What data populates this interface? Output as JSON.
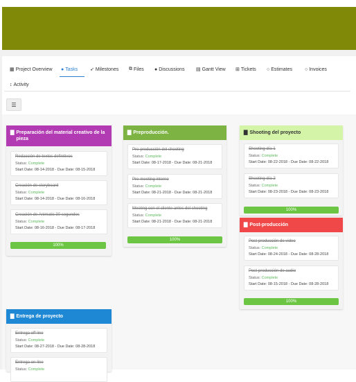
{
  "nav": {
    "tabs": [
      {
        "label": "Project Overview",
        "icon": "grid-icon"
      },
      {
        "label": "Tasks",
        "icon": "check-circle-icon",
        "active": true
      },
      {
        "label": "Milestones",
        "icon": "rocket-icon"
      },
      {
        "label": "Files",
        "icon": "files-icon"
      },
      {
        "label": "Discussions",
        "icon": "comments-icon"
      },
      {
        "label": "Gantt View",
        "icon": "bar-chart-icon"
      },
      {
        "label": "Tickets",
        "icon": "ticket-icon"
      },
      {
        "label": "Estimates",
        "icon": "estimate-icon"
      },
      {
        "label": "Invoices",
        "icon": "invoice-icon"
      },
      {
        "label": "Activity",
        "icon": "activity-icon"
      }
    ]
  },
  "colors": {
    "banner": "#808a08",
    "accent": "#2a7fd4",
    "status": "#5cb85c",
    "progress": "#6cc644"
  },
  "columns": [
    {
      "title": "Preparación del material creativo de la pieza",
      "color": "#b23ab2",
      "tasks": [
        {
          "name": "Redacción de textos definitivos",
          "status_label": "Status:",
          "status": "Complete",
          "dates": "Start Date: 08-14-2018 - Due Date: 08-15-2018"
        },
        {
          "name": "Creación de storyboard",
          "status_label": "Status:",
          "status": "Complete",
          "dates": "Start Date: 08-14-2018 - Due Date: 08-16-2018"
        },
        {
          "name": "Creación de Animatic 30 segundos",
          "status_label": "Status:",
          "status": "Complete",
          "dates": "Start Date: 08-16-2018 - Due Date: 08-17-2018"
        }
      ],
      "progress": "100%",
      "progress_value": 100
    },
    {
      "title": "Preproducción.",
      "color": "#7cb342",
      "tasks": [
        {
          "name": "Pre-producción del shooting",
          "status_label": "Status:",
          "status": "Complete",
          "dates": "Start Date: 08-17-2018 - Due Date: 08-21-2018"
        },
        {
          "name": "Pre-meeting interno",
          "status_label": "Status:",
          "status": "Complete",
          "dates": "Start Date: 08-21-2018 - Due Date: 08-21-2018"
        },
        {
          "name": "Meeting con el cliente antes del shooting",
          "status_label": "Status:",
          "status": "Complete",
          "dates": "Start Date: 08-21-2018 - Due Date: 08-21-2018"
        }
      ],
      "progress": "100%",
      "progress_value": 100
    },
    {
      "title": "Shooting del proyecto",
      "color": "#d4f5a8",
      "tasks": [
        {
          "name": "Shooting día 1",
          "status_label": "Status:",
          "status": "Complete",
          "dates": "Start Date: 08-22-2018 - Due Date: 08-22-2018"
        },
        {
          "name": "Shooting día 2",
          "status_label": "Status:",
          "status": "Complete",
          "dates": "Start Date: 08-23-2018 - Due Date: 08-23-2018"
        }
      ],
      "progress": "100%",
      "progress_value": 100
    },
    {
      "title": "Post-producción",
      "color": "#f04848",
      "tasks": [
        {
          "name": "Post-producción de video",
          "status_label": "Status:",
          "status": "Complete",
          "dates": "Start Date: 08-24-2018 - Due Date: 08-28-2018"
        },
        {
          "name": "Post-producción de audio",
          "status_label": "Status:",
          "status": "Complete",
          "dates": "Start Date: 08-15-2018 - Due Date: 08-28-2018"
        }
      ],
      "progress": "100%",
      "progress_value": 100
    },
    {
      "title": "Entrega de proyecto",
      "color": "#1e88d4",
      "tasks": [
        {
          "name": "Entrega off-line",
          "status_label": "Status:",
          "status": "Complete",
          "dates": "Start Date: 08-27-2018 - Due Date: 08-28-2018"
        },
        {
          "name": "Entrega on-line",
          "status_label": "Status:",
          "status": "Complete",
          "dates": ""
        }
      ]
    }
  ]
}
